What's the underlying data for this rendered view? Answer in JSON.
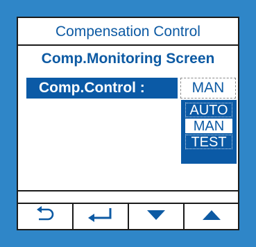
{
  "header": {
    "title": "Compensation Control"
  },
  "screen": {
    "subtitle": "Comp.Monitoring Screen"
  },
  "control": {
    "label": "Comp.Control :",
    "value": "MAN",
    "options": [
      "AUTO",
      "MAN",
      "TEST"
    ],
    "selected_index": 1
  },
  "buttons": [
    {
      "icon": "back-icon"
    },
    {
      "icon": "enter-icon"
    },
    {
      "icon": "arrow-down-icon"
    },
    {
      "icon": "arrow-up-icon"
    }
  ],
  "colors": {
    "frame": "#2f86c8",
    "accent": "#0b5aa6",
    "text": "#0d5aa3"
  }
}
